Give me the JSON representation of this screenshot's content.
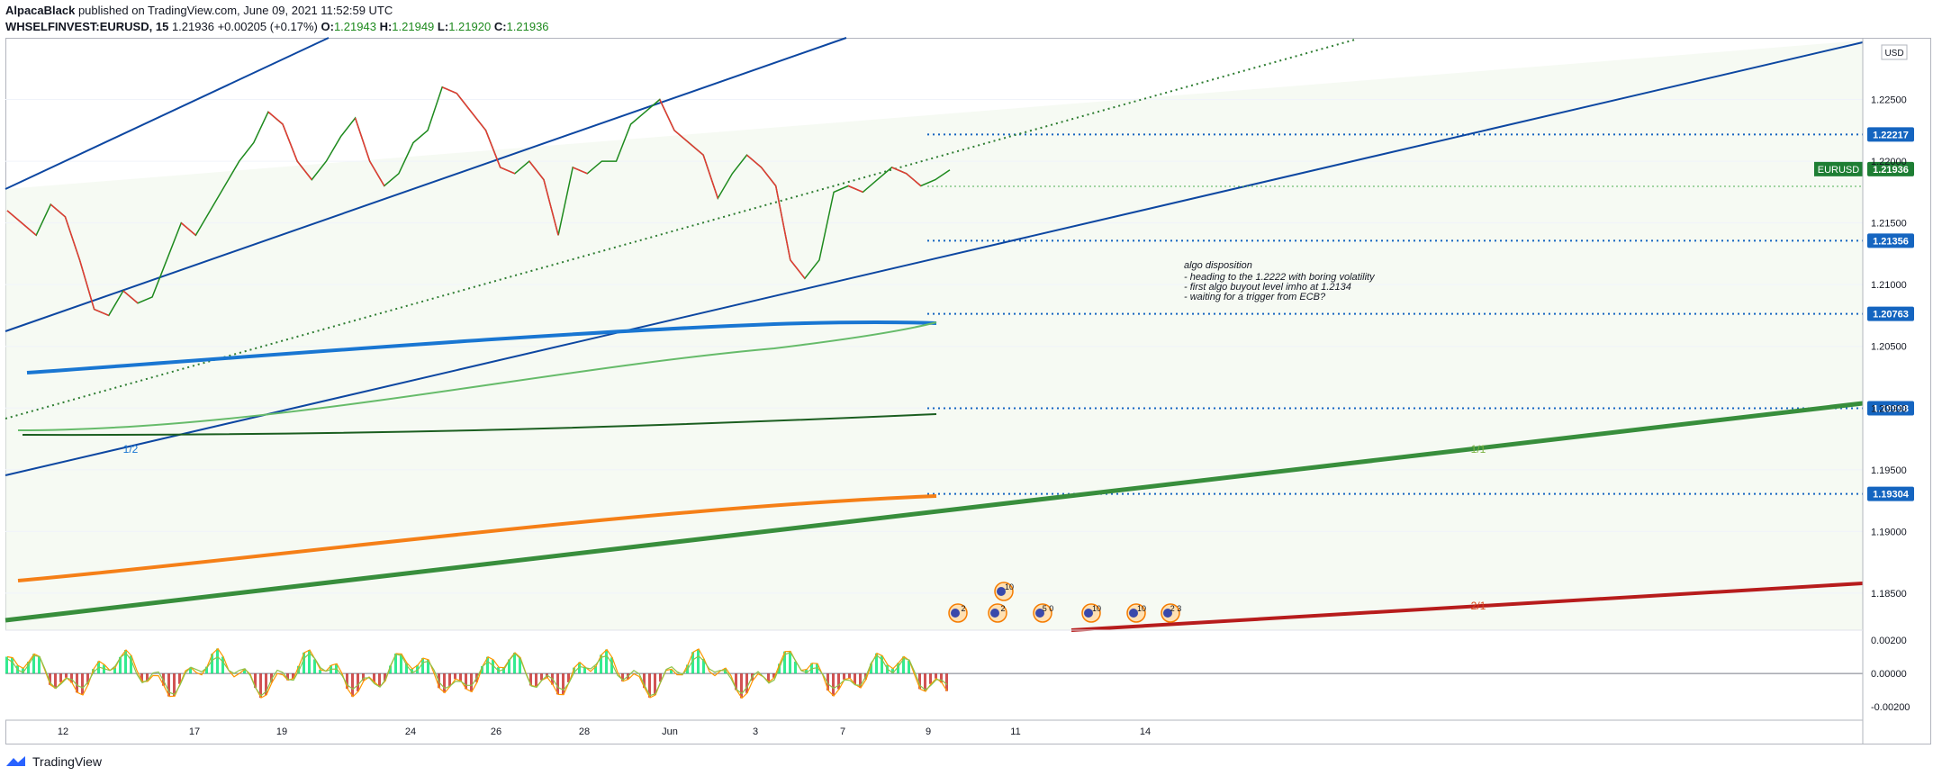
{
  "header": {
    "author": "AlpacaBlack",
    "published": "published on TradingView.com, June 09, 2021 11:52:59 UTC",
    "symbol": "WHSELFINVEST:EURUSD, 15",
    "last": "1.21936",
    "change": "+0.00205 (+0.17%)",
    "o_label": "O:",
    "o": "1.21943",
    "h_label": "H:",
    "h": "1.21949",
    "l_label": "L:",
    "l": "1.21920",
    "c_label": "C:",
    "c": "1.21936"
  },
  "footer": {
    "brand": "TradingView"
  },
  "colors": {
    "up": "#089981",
    "down": "#f23645",
    "channel": "#0d47a1",
    "ma_blue": "#1976d2",
    "ma_green": "#66bb6a",
    "ma_dark": "#1b5e20",
    "ma_orange": "#f57f17",
    "fan1": "#388e3c",
    "fan2": "#b71c1c",
    "level": "#1565c0",
    "last_badge": "#1e7e34"
  },
  "chart_data": [
    {
      "type": "line",
      "title": "",
      "series_name": "EURUSD",
      "currency": "USD",
      "x_ticks": [
        "12",
        "17",
        "19",
        "24",
        "26",
        "28",
        "Jun",
        "3",
        "7",
        "9",
        "11",
        "14"
      ],
      "y_ticks": [
        "1.22500",
        "1.22000",
        "1.21500",
        "1.21000",
        "1.20500",
        "1.20000",
        "1.19500",
        "1.19000",
        "1.18500"
      ],
      "ylim": [
        1.182,
        1.23
      ],
      "close_series": [
        1.216,
        1.215,
        1.214,
        1.2165,
        1.2155,
        1.212,
        1.208,
        1.2075,
        1.2095,
        1.2085,
        1.209,
        1.212,
        1.215,
        1.214,
        1.216,
        1.218,
        1.22,
        1.2215,
        1.224,
        1.223,
        1.22,
        1.2185,
        1.22,
        1.222,
        1.2235,
        1.22,
        1.218,
        1.219,
        1.2215,
        1.2225,
        1.226,
        1.2255,
        1.224,
        1.2225,
        1.2195,
        1.219,
        1.22,
        1.2185,
        1.214,
        1.2195,
        1.219,
        1.22,
        1.22,
        1.223,
        1.224,
        1.225,
        1.2225,
        1.2215,
        1.2205,
        1.217,
        1.219,
        1.2205,
        1.2195,
        1.218,
        1.212,
        1.2105,
        1.212,
        1.2175,
        1.218,
        1.2175,
        1.2185,
        1.2195,
        1.219,
        1.218,
        1.2185,
        1.2193
      ],
      "price_levels": [
        "1.22217",
        "1.21356",
        "1.20763",
        "1.19998",
        "1.19304"
      ],
      "last_price_label": "EURUSD",
      "last_price": "1.21936",
      "fan_labels": [
        "1/2",
        "1/1",
        "2/1"
      ],
      "annotation": {
        "title": "algo disposition",
        "lines": [
          "- heading to the 1.2222 with boring volatility",
          "- first algo buyout level imho at 1.2134",
          "- waiting for a trigger from ECB?"
        ]
      },
      "event_labels": [
        "10",
        "2",
        "2",
        "5 0",
        "10",
        "10",
        "2 3"
      ]
    },
    {
      "type": "line",
      "title": "",
      "y_ticks": [
        "0.00200",
        "0.00000",
        "-0.00200"
      ],
      "ylim": [
        -0.0028,
        0.0026
      ]
    }
  ]
}
